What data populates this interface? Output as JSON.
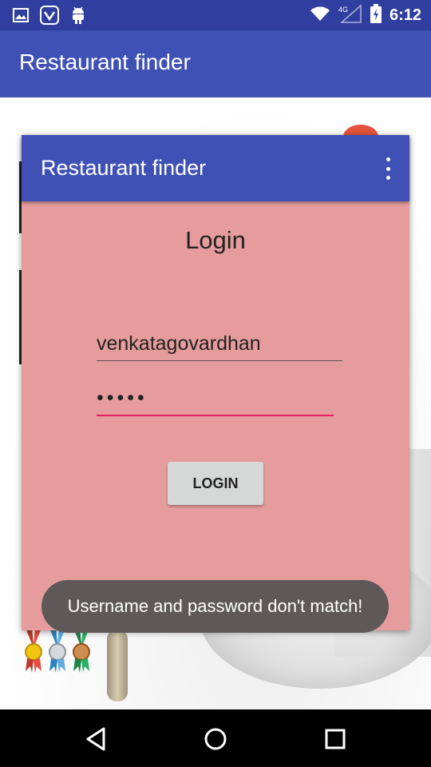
{
  "status_bar": {
    "time": "6:12",
    "network": "4G",
    "icons": [
      "image-icon",
      "saavn-icon",
      "android-icon",
      "wifi-icon",
      "cell-signal-icon",
      "battery-charging-icon"
    ]
  },
  "app_bar": {
    "title": "Restaurant finder"
  },
  "dialog": {
    "title": "Restaurant finder",
    "heading": "Login",
    "username_value": "venkatagovardhan",
    "password_value": "•••••",
    "login_button": "LOGIN"
  },
  "toast": {
    "message": "Username and password don't match!"
  },
  "nav_bar": {
    "icons": [
      "back-icon",
      "home-icon",
      "recents-icon"
    ]
  },
  "colors": {
    "primary": "#3F51B5",
    "primary_dark": "#303F9F",
    "dialog_background": "#E69C9C",
    "accent": "#E91E63",
    "toast": "#5F5859"
  }
}
